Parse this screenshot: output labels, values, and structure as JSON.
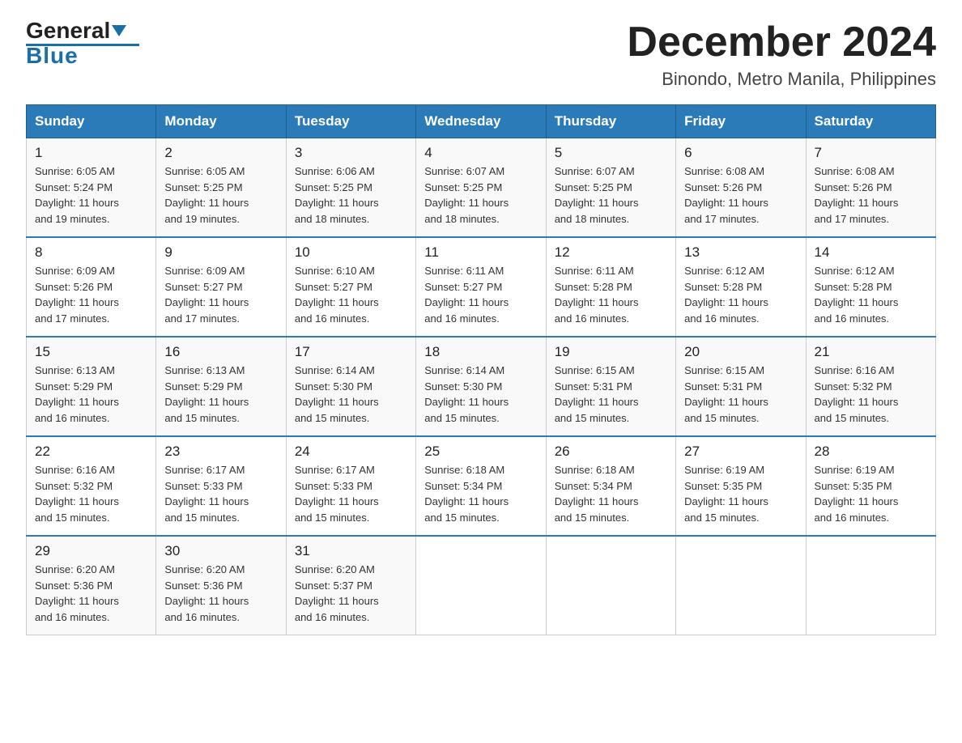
{
  "logo": {
    "general": "General",
    "blue": "Blue"
  },
  "title": "December 2024",
  "subtitle": "Binondo, Metro Manila, Philippines",
  "days": [
    "Sunday",
    "Monday",
    "Tuesday",
    "Wednesday",
    "Thursday",
    "Friday",
    "Saturday"
  ],
  "weeks": [
    [
      {
        "day": "1",
        "sunrise": "6:05 AM",
        "sunset": "5:24 PM",
        "daylight": "11 hours and 19 minutes."
      },
      {
        "day": "2",
        "sunrise": "6:05 AM",
        "sunset": "5:25 PM",
        "daylight": "11 hours and 19 minutes."
      },
      {
        "day": "3",
        "sunrise": "6:06 AM",
        "sunset": "5:25 PM",
        "daylight": "11 hours and 18 minutes."
      },
      {
        "day": "4",
        "sunrise": "6:07 AM",
        "sunset": "5:25 PM",
        "daylight": "11 hours and 18 minutes."
      },
      {
        "day": "5",
        "sunrise": "6:07 AM",
        "sunset": "5:25 PM",
        "daylight": "11 hours and 18 minutes."
      },
      {
        "day": "6",
        "sunrise": "6:08 AM",
        "sunset": "5:26 PM",
        "daylight": "11 hours and 17 minutes."
      },
      {
        "day": "7",
        "sunrise": "6:08 AM",
        "sunset": "5:26 PM",
        "daylight": "11 hours and 17 minutes."
      }
    ],
    [
      {
        "day": "8",
        "sunrise": "6:09 AM",
        "sunset": "5:26 PM",
        "daylight": "11 hours and 17 minutes."
      },
      {
        "day": "9",
        "sunrise": "6:09 AM",
        "sunset": "5:27 PM",
        "daylight": "11 hours and 17 minutes."
      },
      {
        "day": "10",
        "sunrise": "6:10 AM",
        "sunset": "5:27 PM",
        "daylight": "11 hours and 16 minutes."
      },
      {
        "day": "11",
        "sunrise": "6:11 AM",
        "sunset": "5:27 PM",
        "daylight": "11 hours and 16 minutes."
      },
      {
        "day": "12",
        "sunrise": "6:11 AM",
        "sunset": "5:28 PM",
        "daylight": "11 hours and 16 minutes."
      },
      {
        "day": "13",
        "sunrise": "6:12 AM",
        "sunset": "5:28 PM",
        "daylight": "11 hours and 16 minutes."
      },
      {
        "day": "14",
        "sunrise": "6:12 AM",
        "sunset": "5:28 PM",
        "daylight": "11 hours and 16 minutes."
      }
    ],
    [
      {
        "day": "15",
        "sunrise": "6:13 AM",
        "sunset": "5:29 PM",
        "daylight": "11 hours and 16 minutes."
      },
      {
        "day": "16",
        "sunrise": "6:13 AM",
        "sunset": "5:29 PM",
        "daylight": "11 hours and 15 minutes."
      },
      {
        "day": "17",
        "sunrise": "6:14 AM",
        "sunset": "5:30 PM",
        "daylight": "11 hours and 15 minutes."
      },
      {
        "day": "18",
        "sunrise": "6:14 AM",
        "sunset": "5:30 PM",
        "daylight": "11 hours and 15 minutes."
      },
      {
        "day": "19",
        "sunrise": "6:15 AM",
        "sunset": "5:31 PM",
        "daylight": "11 hours and 15 minutes."
      },
      {
        "day": "20",
        "sunrise": "6:15 AM",
        "sunset": "5:31 PM",
        "daylight": "11 hours and 15 minutes."
      },
      {
        "day": "21",
        "sunrise": "6:16 AM",
        "sunset": "5:32 PM",
        "daylight": "11 hours and 15 minutes."
      }
    ],
    [
      {
        "day": "22",
        "sunrise": "6:16 AM",
        "sunset": "5:32 PM",
        "daylight": "11 hours and 15 minutes."
      },
      {
        "day": "23",
        "sunrise": "6:17 AM",
        "sunset": "5:33 PM",
        "daylight": "11 hours and 15 minutes."
      },
      {
        "day": "24",
        "sunrise": "6:17 AM",
        "sunset": "5:33 PM",
        "daylight": "11 hours and 15 minutes."
      },
      {
        "day": "25",
        "sunrise": "6:18 AM",
        "sunset": "5:34 PM",
        "daylight": "11 hours and 15 minutes."
      },
      {
        "day": "26",
        "sunrise": "6:18 AM",
        "sunset": "5:34 PM",
        "daylight": "11 hours and 15 minutes."
      },
      {
        "day": "27",
        "sunrise": "6:19 AM",
        "sunset": "5:35 PM",
        "daylight": "11 hours and 15 minutes."
      },
      {
        "day": "28",
        "sunrise": "6:19 AM",
        "sunset": "5:35 PM",
        "daylight": "11 hours and 16 minutes."
      }
    ],
    [
      {
        "day": "29",
        "sunrise": "6:20 AM",
        "sunset": "5:36 PM",
        "daylight": "11 hours and 16 minutes."
      },
      {
        "day": "30",
        "sunrise": "6:20 AM",
        "sunset": "5:36 PM",
        "daylight": "11 hours and 16 minutes."
      },
      {
        "day": "31",
        "sunrise": "6:20 AM",
        "sunset": "5:37 PM",
        "daylight": "11 hours and 16 minutes."
      },
      null,
      null,
      null,
      null
    ]
  ],
  "labels": {
    "sunrise": "Sunrise:",
    "sunset": "Sunset:",
    "daylight": "Daylight:"
  }
}
